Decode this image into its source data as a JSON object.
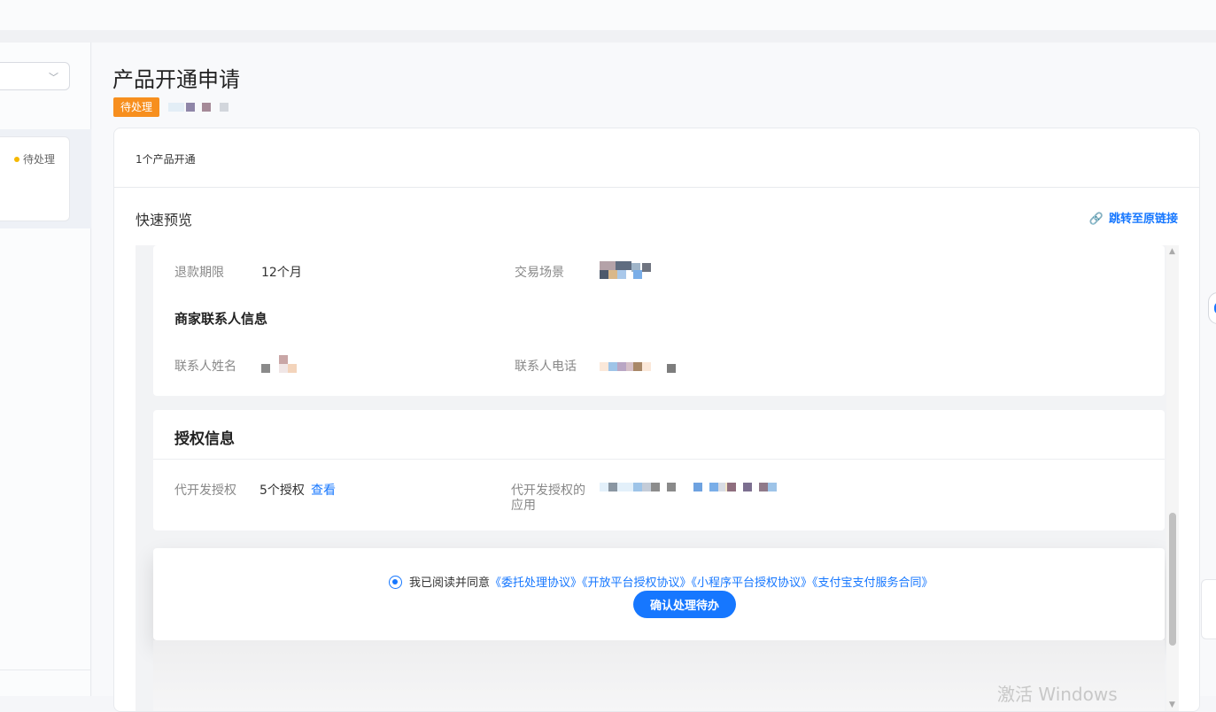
{
  "sidebar": {
    "item_status": "待处理"
  },
  "header": {
    "title": "产品开通申请",
    "badge": "待处理"
  },
  "panel": {
    "count_label": "1个产品开通",
    "preview_title": "快速预览",
    "jump_link": "跳转至原链接"
  },
  "refund": {
    "label": "退款期限",
    "value": "12个月",
    "scene_label": "交易场景"
  },
  "merchant_contact": {
    "title": "商家联系人信息",
    "name_label": "联系人姓名",
    "phone_label": "联系人电话"
  },
  "authorization": {
    "title": "授权信息",
    "dev_label": "代开发授权",
    "dev_value": "5个授权",
    "view_link": "查看",
    "apps_label_line1": "代开发授权的",
    "apps_label_line2": "应用"
  },
  "agreement": {
    "prefix": "我已阅读并同意",
    "links": "《委托处理协议》《开放平台授权协议》《小程序平台授权协议》《支付宝支付服务合同》",
    "confirm_button": "确认处理待办"
  },
  "watermark": "激活 Windows",
  "colors": {
    "accent": "#1677ff",
    "badge": "#f78f1e",
    "pending_dot": "#f5b800"
  }
}
